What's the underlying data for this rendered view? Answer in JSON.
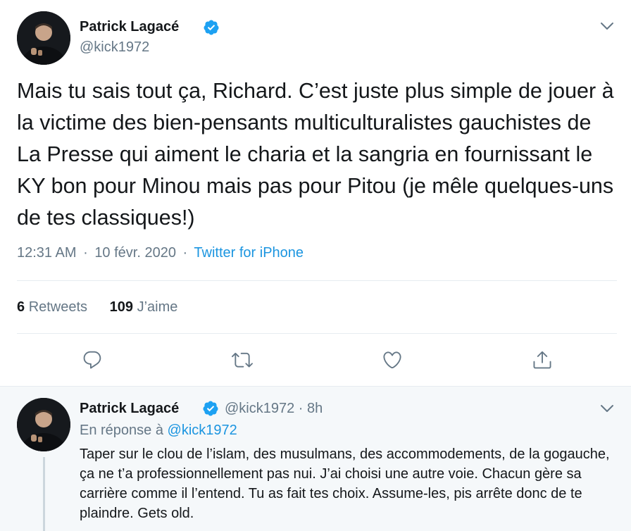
{
  "tweet": {
    "display_name": "Patrick Lagacé",
    "handle": "@kick1972",
    "text": "Mais tu sais tout ça, Richard. C’est juste plus simple de jouer à la victime des bien-pensants multiculturalistes gauchistes de La Presse qui aiment le charia et la sangria en fournissant le KY bon pour Minou mais pas pour Pitou (je mêle quelques-uns de tes classiques!)",
    "time": "12:31 AM",
    "date": "10 févr. 2020",
    "separator": "·",
    "source": "Twitter for iPhone",
    "retweets_count": "6",
    "retweets_label": "Retweets",
    "likes_count": "109",
    "likes_label": "J’aime"
  },
  "icons": {
    "verified": "verified-badge-icon",
    "menu": "chevron-down-icon",
    "reply": "reply-icon",
    "retweet": "retweet-icon",
    "like": "heart-icon",
    "share": "share-icon"
  },
  "reply": {
    "display_name": "Patrick Lagacé",
    "handle_time": "@kick1972 · 8h",
    "in_reply_prefix": "En réponse à",
    "in_reply_handle": "@kick1972",
    "text": "Taper sur le clou de l’islam, des musulmans, des accommodements, de la gogauche, ça ne t’a professionnellement pas nui. J’ai choisi une autre voie. Chacun gère sa carrière comme il l’entend. Tu as fait tes choix. Assume-les, pis arrête donc de te plaindre. Gets old."
  },
  "colors": {
    "accent": "#1b95e0",
    "secondary_text": "#657786",
    "reply_background": "#f5f8fa"
  }
}
